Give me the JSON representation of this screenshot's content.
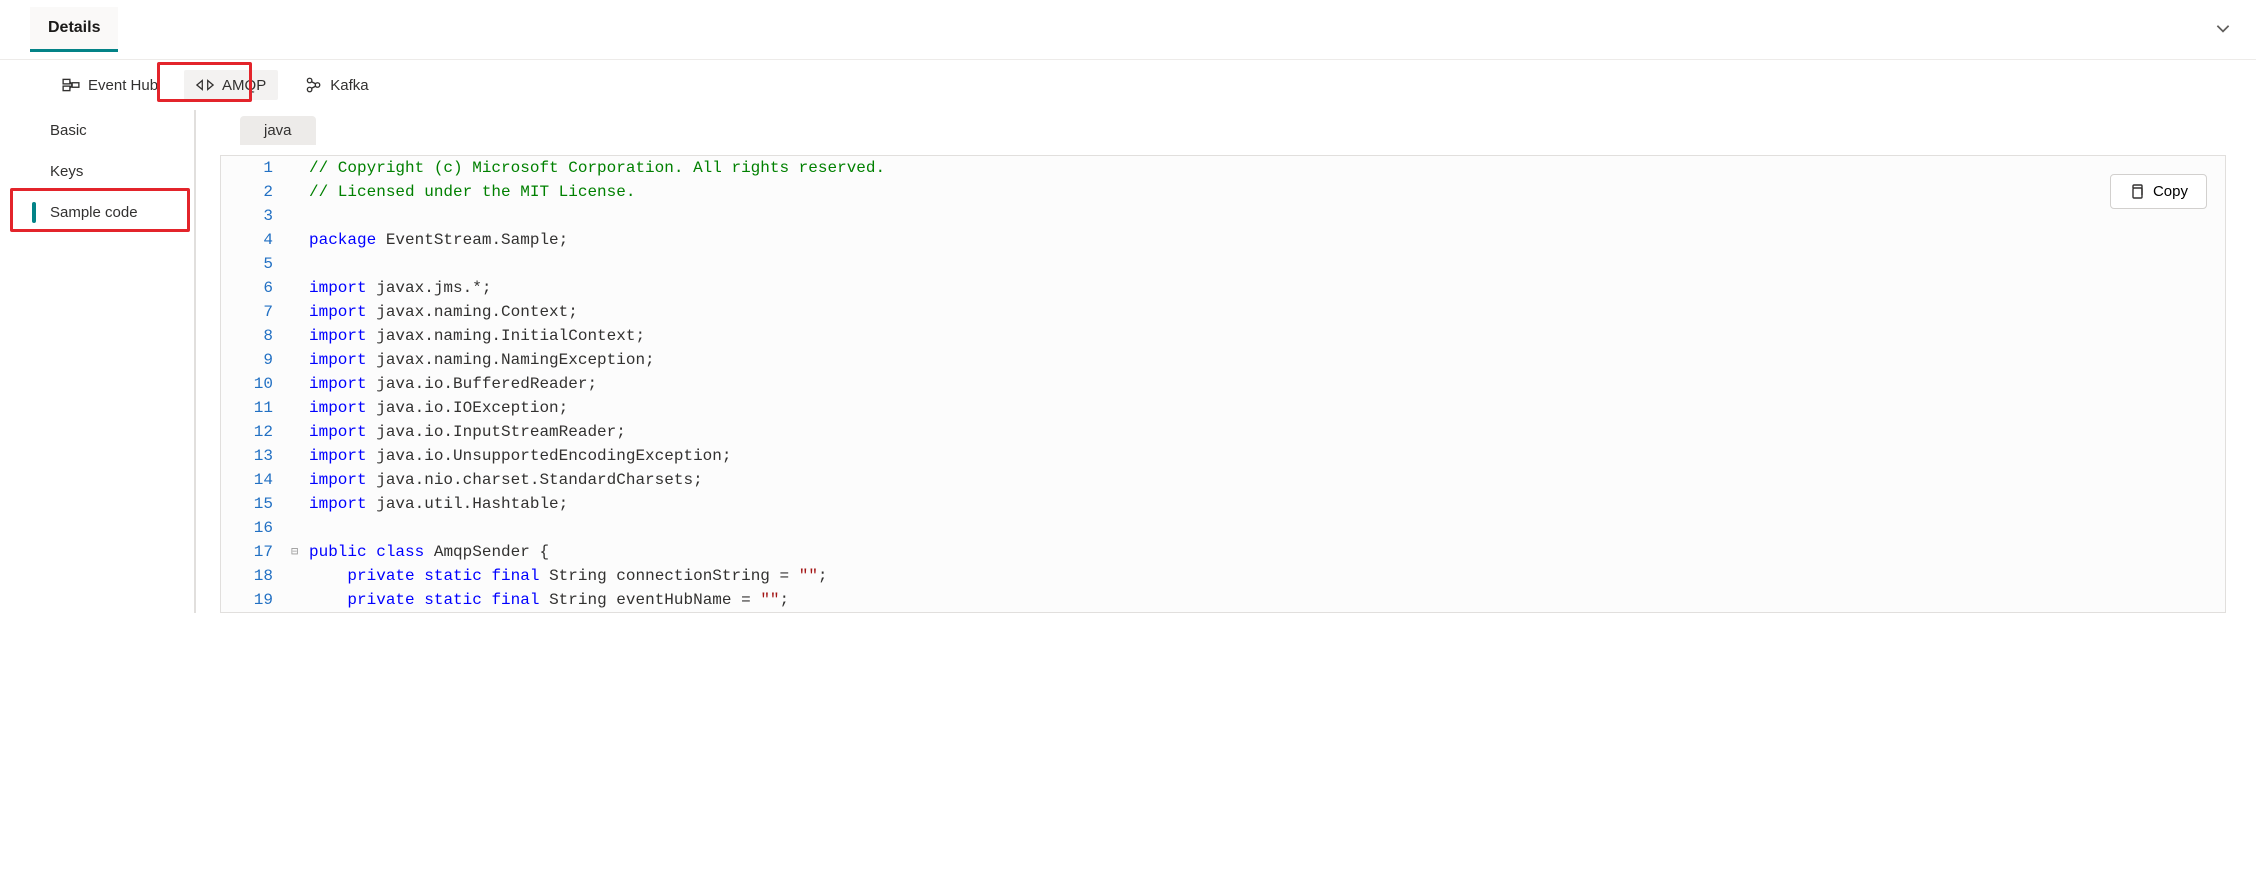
{
  "header": {
    "tab_label": "Details"
  },
  "protocols": [
    {
      "id": "eventhub",
      "label": "Event Hub",
      "selected": false
    },
    {
      "id": "amqp",
      "label": "AMQP",
      "selected": true
    },
    {
      "id": "kafka",
      "label": "Kafka",
      "selected": false
    }
  ],
  "sidebar": [
    {
      "id": "basic",
      "label": "Basic",
      "active": false
    },
    {
      "id": "keys",
      "label": "Keys",
      "active": false
    },
    {
      "id": "sample-code",
      "label": "Sample code",
      "active": true
    }
  ],
  "language_tab": "java",
  "copy_label": "Copy",
  "code": {
    "lines": [
      {
        "n": 1,
        "tokens": [
          [
            "comment",
            "// Copyright (c) Microsoft Corporation. All rights reserved."
          ]
        ]
      },
      {
        "n": 2,
        "tokens": [
          [
            "comment",
            "// Licensed under the MIT License."
          ]
        ]
      },
      {
        "n": 3,
        "tokens": []
      },
      {
        "n": 4,
        "tokens": [
          [
            "keyword",
            "package"
          ],
          [
            "normal",
            " EventStream.Sample;"
          ]
        ]
      },
      {
        "n": 5,
        "tokens": []
      },
      {
        "n": 6,
        "tokens": [
          [
            "keyword",
            "import"
          ],
          [
            "normal",
            " javax.jms.*;"
          ]
        ]
      },
      {
        "n": 7,
        "tokens": [
          [
            "keyword",
            "import"
          ],
          [
            "normal",
            " javax.naming.Context;"
          ]
        ]
      },
      {
        "n": 8,
        "tokens": [
          [
            "keyword",
            "import"
          ],
          [
            "normal",
            " javax.naming.InitialContext;"
          ]
        ]
      },
      {
        "n": 9,
        "tokens": [
          [
            "keyword",
            "import"
          ],
          [
            "normal",
            " javax.naming.NamingException;"
          ]
        ]
      },
      {
        "n": 10,
        "tokens": [
          [
            "keyword",
            "import"
          ],
          [
            "normal",
            " java.io.BufferedReader;"
          ]
        ]
      },
      {
        "n": 11,
        "tokens": [
          [
            "keyword",
            "import"
          ],
          [
            "normal",
            " java.io.IOException;"
          ]
        ]
      },
      {
        "n": 12,
        "tokens": [
          [
            "keyword",
            "import"
          ],
          [
            "normal",
            " java.io.InputStreamReader;"
          ]
        ]
      },
      {
        "n": 13,
        "tokens": [
          [
            "keyword",
            "import"
          ],
          [
            "normal",
            " java.io.UnsupportedEncodingException;"
          ]
        ]
      },
      {
        "n": 14,
        "tokens": [
          [
            "keyword",
            "import"
          ],
          [
            "normal",
            " java.nio.charset.StandardCharsets;"
          ]
        ]
      },
      {
        "n": 15,
        "tokens": [
          [
            "keyword",
            "import"
          ],
          [
            "normal",
            " java.util.Hashtable;"
          ]
        ]
      },
      {
        "n": 16,
        "tokens": []
      },
      {
        "n": 17,
        "fold": "⊟",
        "tokens": [
          [
            "keyword",
            "public"
          ],
          [
            "normal",
            " "
          ],
          [
            "keyword",
            "class"
          ],
          [
            "normal",
            " AmqpSender {"
          ]
        ]
      },
      {
        "n": 18,
        "tokens": [
          [
            "normal",
            "    "
          ],
          [
            "keyword",
            "private"
          ],
          [
            "normal",
            " "
          ],
          [
            "keyword",
            "static"
          ],
          [
            "normal",
            " "
          ],
          [
            "keyword",
            "final"
          ],
          [
            "normal",
            " String connectionString = "
          ],
          [
            "string",
            "\"\""
          ],
          [
            "normal",
            ";"
          ]
        ]
      },
      {
        "n": 19,
        "tokens": [
          [
            "normal",
            "    "
          ],
          [
            "keyword",
            "private"
          ],
          [
            "normal",
            " "
          ],
          [
            "keyword",
            "static"
          ],
          [
            "normal",
            " "
          ],
          [
            "keyword",
            "final"
          ],
          [
            "normal",
            " String eventHubName = "
          ],
          [
            "string",
            "\"\""
          ],
          [
            "normal",
            ";"
          ]
        ]
      }
    ]
  }
}
